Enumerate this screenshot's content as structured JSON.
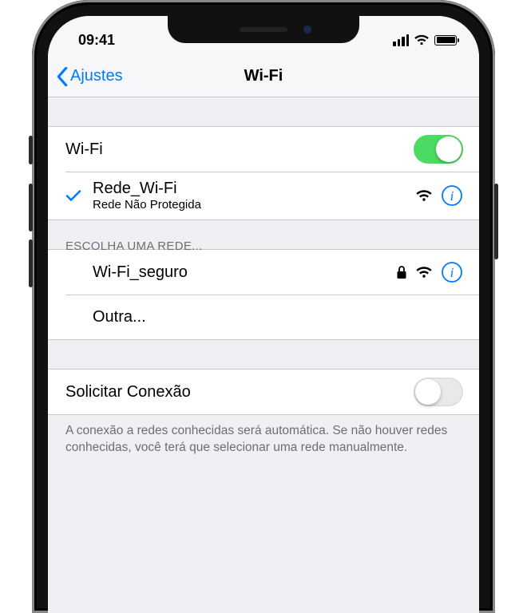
{
  "status": {
    "time": "09:41"
  },
  "nav": {
    "back_label": "Ajustes",
    "title": "Wi-Fi"
  },
  "wifi_toggle": {
    "label": "Wi-Fi",
    "on": true
  },
  "connected": {
    "name": "Rede_Wi-Fi",
    "subtitle": "Rede Não Protegida"
  },
  "choose_header": "ESCOLHA UMA REDE...",
  "networks": [
    {
      "name": "Wi-Fi_seguro",
      "secure": true
    }
  ],
  "other_label": "Outra...",
  "ask_join": {
    "label": "Solicitar Conexão",
    "on": false
  },
  "footer": "A conexão a redes conhecidas será automática. Se não houver redes conhecidas, você terá que selecionar uma rede manualmente."
}
